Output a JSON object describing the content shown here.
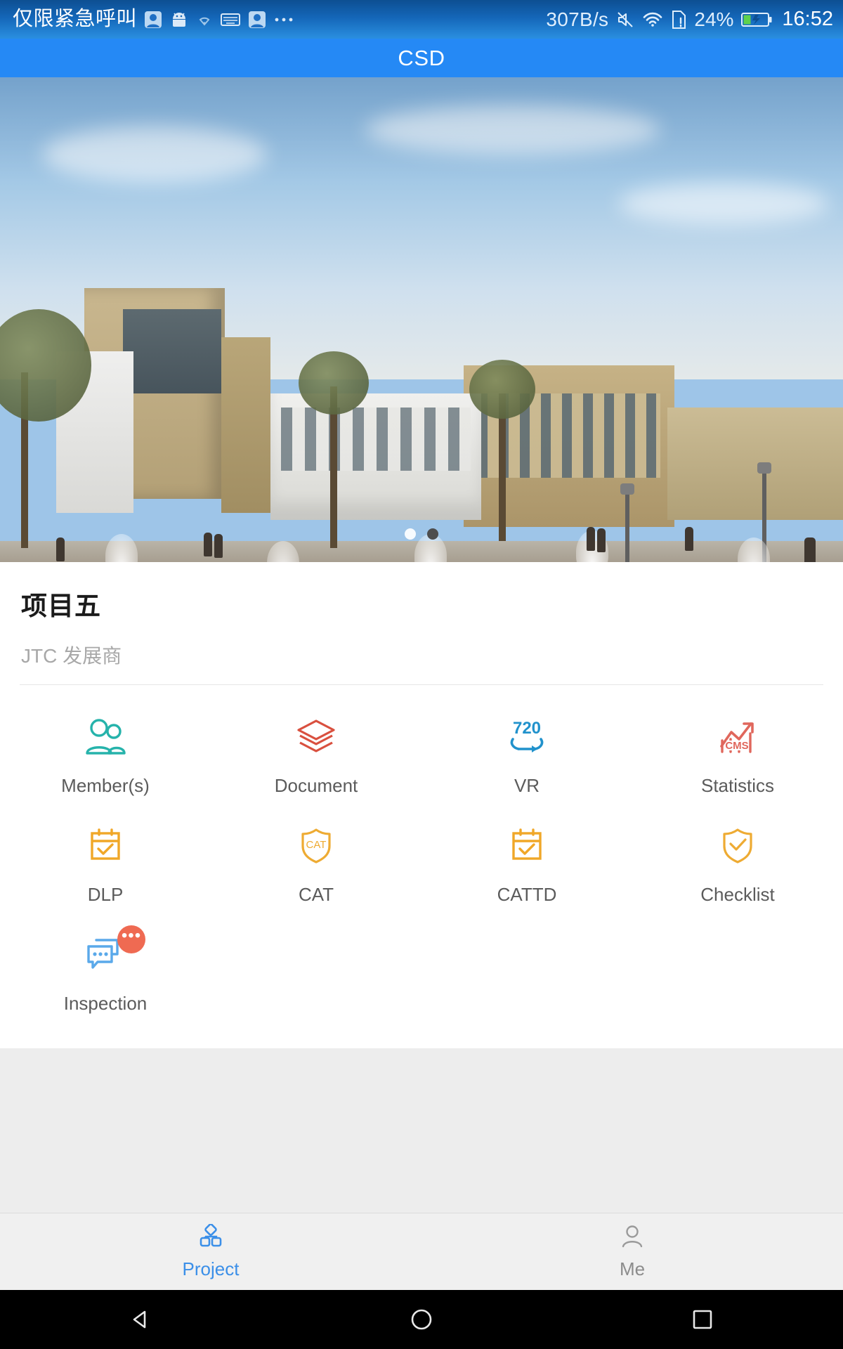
{
  "status_bar": {
    "carrier": "仅限紧急呼叫",
    "left_icons": [
      "app-notification-icon",
      "android-icon",
      "wifi-weak-icon",
      "keyboard-icon",
      "app-notification-icon",
      "more-notifications-icon"
    ],
    "network_speed": "307B/s",
    "right_icons": [
      "mute-icon",
      "wifi-icon",
      "sim-card-alert-icon"
    ],
    "battery_percent": "24%",
    "battery_state": "charging",
    "time": "16:52"
  },
  "app_bar": {
    "title": "CSD",
    "background": "#2589f5"
  },
  "carousel": {
    "slide_alt": "project-building-rendering",
    "dots": [
      {
        "name": "carousel-dot-1",
        "active": false
      },
      {
        "name": "carousel-dot-2",
        "active": true
      }
    ],
    "total_slides": 2,
    "active_index": 1
  },
  "project": {
    "title": "项目五",
    "subtitle": "JTC 发展商"
  },
  "modules": [
    {
      "label": "Member(s)",
      "icon": "members-icon",
      "color": "#26b3ab",
      "badge": null
    },
    {
      "label": "Document",
      "icon": "document-layers-icon",
      "color": "#d9503f",
      "badge": null
    },
    {
      "label": "VR",
      "icon": "vr-720-icon",
      "color": "#2192cc",
      "badge": null,
      "icon_text": "720"
    },
    {
      "label": "Statistics",
      "icon": "statistics-cms-chart-icon",
      "color": "#e0675c",
      "badge": null,
      "icon_text": "CMS"
    },
    {
      "label": "DLP",
      "icon": "calendar-check-icon",
      "color": "#f0a728",
      "badge": null
    },
    {
      "label": "CAT",
      "icon": "shield-cat-icon",
      "color": "#eeab33",
      "badge": null,
      "icon_text": "CAT"
    },
    {
      "label": "CATTD",
      "icon": "calendar-check-icon",
      "color": "#f0a728",
      "badge": null
    },
    {
      "label": "Checklist",
      "icon": "shield-check-icon",
      "color": "#eeab33",
      "badge": null
    },
    {
      "label": "Inspection",
      "icon": "chat-bubbles-icon",
      "color": "#5aa9ea",
      "badge": "•••",
      "badge_color": "#ef6a52"
    }
  ],
  "tab_bar": [
    {
      "label": "Project",
      "icon": "hierarchy-icon",
      "active": true,
      "color": "#3b8fe8"
    },
    {
      "label": "Me",
      "icon": "person-icon",
      "active": false,
      "color": "#8c8c8c"
    }
  ],
  "nav_bar": [
    "back-triangle-icon",
    "home-circle-icon",
    "recents-square-icon"
  ]
}
